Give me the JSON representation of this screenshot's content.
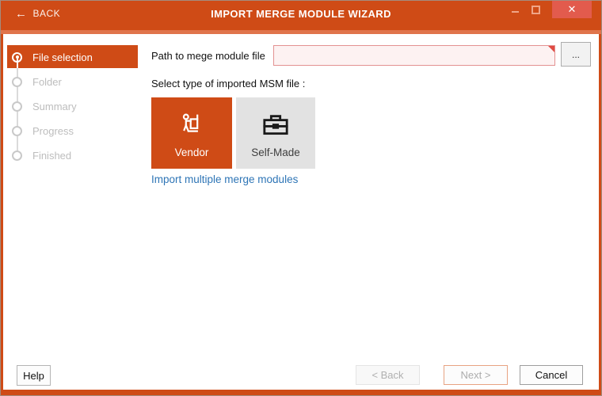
{
  "colors": {
    "accent": "#CF4B16",
    "accent_light": "#E0744B",
    "close_button": "#E25B4D",
    "link": "#2E75B6",
    "error_field_bg": "#FDF2F2",
    "error_field_border": "#E39292"
  },
  "titlebar": {
    "back_label": "BACK",
    "back_glyph": "←",
    "title": "IMPORT MERGE MODULE WIZARD",
    "close_glyph": "✕"
  },
  "stepper": {
    "steps": [
      {
        "label": "File selection",
        "state": "active"
      },
      {
        "label": "Folder",
        "state": "idle"
      },
      {
        "label": "Summary",
        "state": "idle"
      },
      {
        "label": "Progress",
        "state": "idle"
      },
      {
        "label": "Finished",
        "state": "idle"
      }
    ]
  },
  "form": {
    "path_label": "Path to mege module file",
    "path_value": "",
    "browse_label": "...",
    "type_label": "Select type of imported MSM file :",
    "tiles": [
      {
        "label": "Vendor",
        "selected": true,
        "icon": "vendor-handtruck-icon"
      },
      {
        "label": "Self-Made",
        "selected": false,
        "icon": "toolbox-icon"
      }
    ],
    "link_label": "Import multiple merge modules"
  },
  "footer": {
    "help_label": "Help",
    "back_label": "< Back",
    "next_label": "Next >",
    "cancel_label": "Cancel"
  }
}
